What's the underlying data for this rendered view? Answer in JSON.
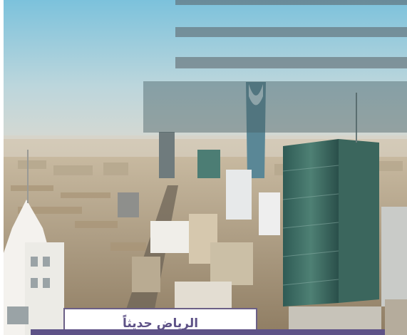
{
  "image": {
    "subject": "city-skyline-photo",
    "palette": {
      "sky_top": "#7fc3dd",
      "sky_bottom": "#d9dcd6",
      "city_ground": "#b9a88a",
      "tower_glass": "#3f6b63",
      "accent": "#5e5287"
    }
  },
  "caption": {
    "text": "الرياض حديثاً"
  }
}
